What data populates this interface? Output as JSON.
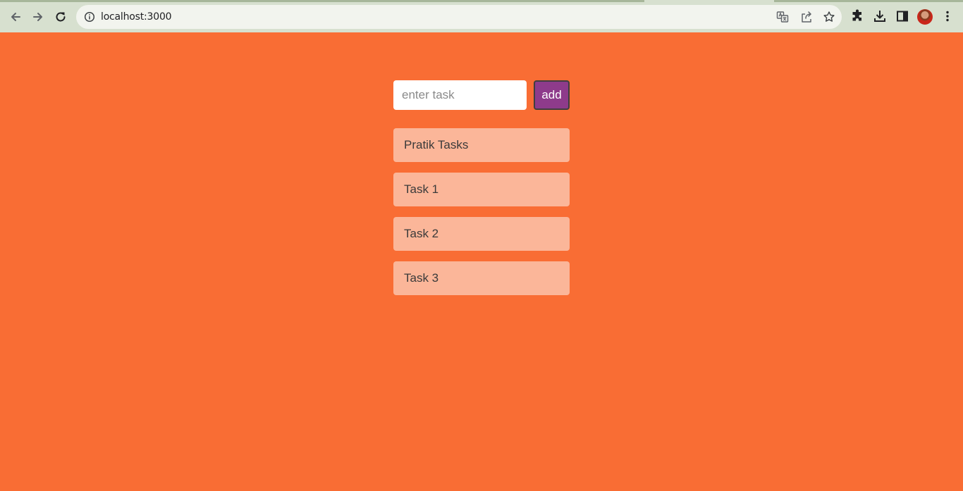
{
  "browser": {
    "url": "localhost:3000",
    "icons": {
      "back": "arrow-left-icon",
      "forward": "arrow-right-icon",
      "reload": "reload-icon",
      "site_info": "info-icon",
      "translate": "translate-icon",
      "share": "share-icon",
      "bookmark": "star-icon",
      "extensions": "puzzle-icon",
      "downloads": "download-icon",
      "side_panel": "side-panel-icon",
      "profile": "avatar",
      "menu": "kebab-menu-icon"
    }
  },
  "page": {
    "background_color": "#f96d34",
    "input": {
      "placeholder": "enter task",
      "value": ""
    },
    "add_button": {
      "label": "add",
      "color": "#8e3b8b"
    },
    "tasks": [
      {
        "label": "Pratik Tasks"
      },
      {
        "label": "Task 1"
      },
      {
        "label": "Task 2"
      },
      {
        "label": "Task 3"
      }
    ],
    "task_color": "#fbb699"
  }
}
